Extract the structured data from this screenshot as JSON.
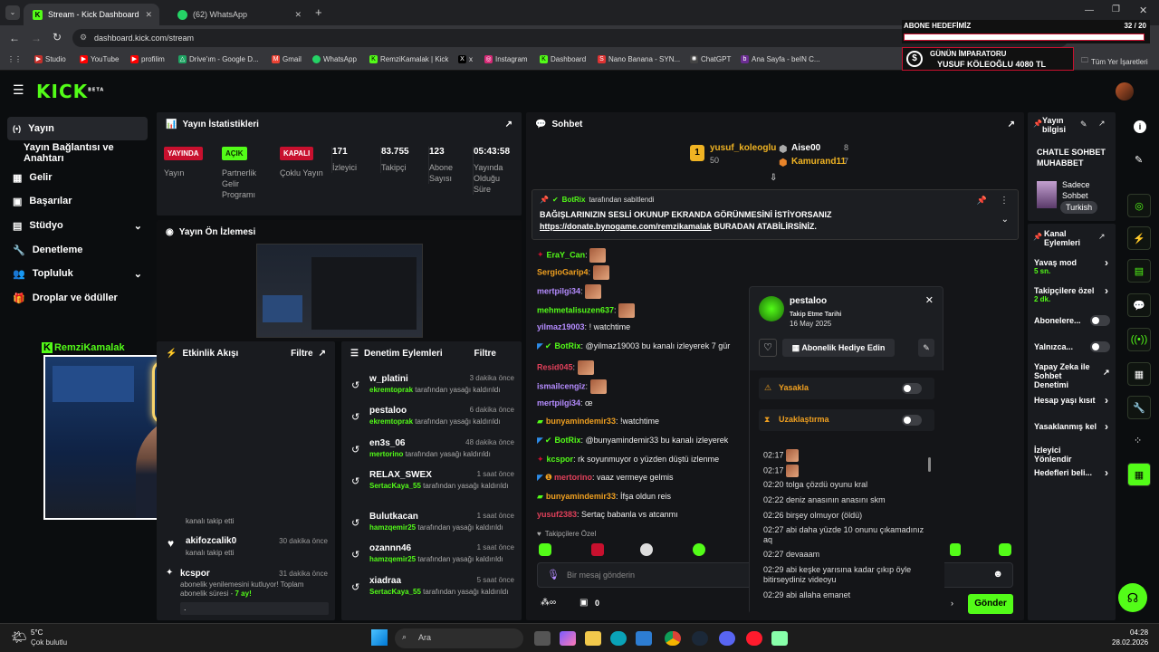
{
  "browser": {
    "tabs": [
      {
        "label": "Stream - Kick Dashboard"
      },
      {
        "label": "(62) WhatsApp"
      }
    ],
    "url": "dashboard.kick.com/stream",
    "bookmarks": [
      "Studio",
      "YouTube",
      "profilim",
      "Drive'ım - Google D...",
      "Gmail",
      "WhatsApp",
      "RemziKamalak | Kick",
      "x",
      "Instagram",
      "Dashboard",
      "Nano Banana - SYN...",
      "ChatGPT",
      "Ana Sayfa - beIN C..."
    ],
    "all_bookmarks": "Tüm Yer İşaretleri"
  },
  "overlay": {
    "goal_label": "ABONE HEDEFİMİZ",
    "goal_current": "32",
    "goal_sep": "/",
    "goal_target": "20",
    "goal_progress": 1.0,
    "emperor_title": "GÜNÜN İMPARATORU",
    "emperor_text": "YUSUF KÖLEOĞLU 4080 TL"
  },
  "kick": {
    "logo": "KICK",
    "beta": "BETA"
  },
  "sidebar": {
    "items": [
      {
        "label": "Yayın",
        "active": true
      },
      {
        "label": "Yayın Bağlantısı ve Anahtarı"
      },
      {
        "label": "Gelir"
      },
      {
        "label": "Başarılar"
      },
      {
        "label": "Stüdyo"
      },
      {
        "label": "Denetleme"
      },
      {
        "label": "Topluluk"
      },
      {
        "label": "Droplar ve ödüller"
      }
    ]
  },
  "stats": {
    "title": "Yayın İstatistikleri",
    "items": [
      {
        "badge": "YAYINDA",
        "label": "Yayın",
        "badge_color": "#c8102e"
      },
      {
        "badge": "AÇIK",
        "label": "Partnerlik Gelir Programı",
        "badge_color": "#53fc18"
      },
      {
        "badge": "KAPALI",
        "label": "Çoklu Yayın",
        "badge_color": "#c8102e"
      },
      {
        "value": "171",
        "label": "İzleyici"
      },
      {
        "value": "83.755",
        "label": "Takipçi"
      },
      {
        "value": "123",
        "label": "Abone Sayısı"
      },
      {
        "value": "05:43:58",
        "label": "Yayında Olduğu Süre"
      }
    ]
  },
  "preview": {
    "title": "Yayın Ön İzlemesi"
  },
  "webcam": {
    "name": "RemziKamalak",
    "letters": "RK"
  },
  "activity": {
    "title": "Etkinlik Akışı",
    "filter": "Filtre",
    "items": [
      {
        "name": "",
        "desc": "kanalı takip etti",
        "time": ""
      },
      {
        "name": "akifozcalik0",
        "desc": "kanalı takip etti",
        "time": "30 dakika önce"
      },
      {
        "name": "kcspor",
        "desc": "abonelik yenilemesini kutluyor! Toplam abonelik süresi - ",
        "months": "7",
        "months_unit": "ay!",
        "time": "31 dakika önce"
      }
    ],
    "input_value": "."
  },
  "moderation": {
    "title": "Denetim Eylemleri",
    "filter": "Filtre",
    "items": [
      {
        "name": "w_platini",
        "mod": "ekremtoprak",
        "text": "tarafından yasağı kaldırıldı",
        "time": "3 dakika önce"
      },
      {
        "name": "pestaloo",
        "mod": "ekremtoprak",
        "text": "tarafından yasağı kaldırıldı",
        "time": "6 dakika önce"
      },
      {
        "name": "en3s_06",
        "mod": "mertorino",
        "text": "tarafından yasağı kaldırıldı",
        "time": "48 dakika önce"
      },
      {
        "name": "RELAX_SWEX",
        "mod": "SertacKaya_55",
        "text": "tarafından yasağı kaldırıldı",
        "time": "1 saat önce"
      },
      {
        "name": "Bulutkacan",
        "mod": "hamzqemir25",
        "text": "tarafından yasağı kaldırıldı",
        "time": "1 saat önce"
      },
      {
        "name": "ozannn46",
        "mod": "hamzqemir25",
        "text": "tarafından yasağı kaldırıldı",
        "time": "1 saat önce"
      },
      {
        "name": "xiadraa",
        "mod": "SertacKaya_55",
        "text": "tarafından yasağı kaldırıldı",
        "time": "5 saat önce"
      }
    ]
  },
  "chat": {
    "title": "Sohbet",
    "top": [
      {
        "rank": "1",
        "name": "yusuf_koleoglu",
        "count": "50"
      },
      {
        "name": "Aise00",
        "count": "8"
      },
      {
        "name": "Kamurand11",
        "count": "7"
      }
    ],
    "pinned_by": "BotRix",
    "pinned_suffix": "tarafından sabitlendi",
    "pinned_line1": "BAĞIŞLARINIZIN SESLİ OKUNUP EKRANDA GÖRÜNMESİNİ İSTİYORSANIZ",
    "pinned_link": "https://donate.bynogame.com/remzikamalak",
    "pinned_line2": " BURADAN ATABİLİRSİNİZ.",
    "messages": [
      {
        "user": "EraY_Can",
        "color": "#53fc18",
        "text": ""
      },
      {
        "user": "SergioGarip4",
        "color": "#f0a020",
        "text": ""
      },
      {
        "user": "mertpilgi34",
        "color": "#b58cff",
        "text": ""
      },
      {
        "user": "mehmetalisuzen637",
        "color": "#53fc18",
        "text": ""
      },
      {
        "user": "yilmaz19003",
        "color": "#b58cff",
        "text": "! watchtime"
      },
      {
        "user": "BotRix",
        "color": "#53fc18",
        "text": "@yilmaz19003 bu kanalı izleyerek 7 gür"
      },
      {
        "user": "Resid045",
        "color": "#e0405a",
        "text": ""
      },
      {
        "user": "ismailcengiz",
        "color": "#b58cff",
        "text": ""
      },
      {
        "user": "mertpilgi34",
        "color": "#b58cff",
        "text": "œ"
      },
      {
        "user": "bunyamindemir33",
        "color": "#f0a020",
        "text": "!watchtime"
      },
      {
        "user": "BotRix",
        "color": "#53fc18",
        "text": "@bunyamindemir33 bu kanalı izleyerek"
      },
      {
        "user": "kcspor",
        "color": "#53fc18",
        "text": "rk soyunmuyor o yüzden düştü izlenme"
      },
      {
        "user": "mertorino",
        "color": "#e0405a",
        "text": "vaaz vermeye gelmis"
      },
      {
        "user": "bunyamindemir33",
        "color": "#f0a020",
        "text": "İfşa oldun reis"
      },
      {
        "user": "yusuf2383",
        "color": "#e0405a",
        "text": "Sertaç babanla vs atcanmı"
      }
    ],
    "followers_only": "Takipçilere Özel",
    "input_placeholder": "Bir mesaj gönderin",
    "points": "0",
    "send": "Gönder"
  },
  "user_card": {
    "name": "pestaloo",
    "follow_label": "Takip Etme Tarihi",
    "follow_date": "16 May 2025",
    "gift_button": "Abonelik Hediye Edin",
    "ban": "Yasakla",
    "timeout": "Uzaklaştırma",
    "messages": [
      {
        "time": "02:17",
        "text": ""
      },
      {
        "time": "02:17",
        "text": ""
      },
      {
        "time": "02:20",
        "text": "tolga çözdü oyunu kral"
      },
      {
        "time": "02:22",
        "text": "deniz anasının anasını skm"
      },
      {
        "time": "02:26",
        "text": "birşey olmuyor (öldü)"
      },
      {
        "time": "02:27",
        "text": "abi daha yüzde 10 onunu çıkamadınız aq"
      },
      {
        "time": "02:27",
        "text": "devaaam"
      },
      {
        "time": "02:29",
        "text": "abi keşke yarısına kadar çıkıp öyle bitirseydiniz videoyu"
      },
      {
        "time": "02:29",
        "text": "abi allaha emanet"
      }
    ]
  },
  "stream_info": {
    "title": "Yayın bilgisi",
    "stream_title": "CHATLE SOHBET MUHABBET",
    "category": "Sadece Sohbet",
    "language": "Turkish",
    "actions_title": "Kanal Eylemleri",
    "actions": [
      {
        "label": "Yavaş mod",
        "sub": "5 sn."
      },
      {
        "label": "Takipçilere özel",
        "sub": "2 dk."
      },
      {
        "label": "Abonelere..."
      },
      {
        "label": "Yalnızca..."
      },
      {
        "label": "Yapay Zeka ile Sohbet Denetimi"
      },
      {
        "label": "Hesap yaşı kısıt"
      },
      {
        "label": "Yasaklanmış kel"
      },
      {
        "label": "İzleyici Yönlendir"
      },
      {
        "label": "Hedefleri beli..."
      }
    ]
  },
  "taskbar": {
    "weather_temp": "5°C",
    "weather_desc": "Çok bulutlu",
    "search": "Ara",
    "time": "04:28",
    "date": "28.02.2026"
  }
}
